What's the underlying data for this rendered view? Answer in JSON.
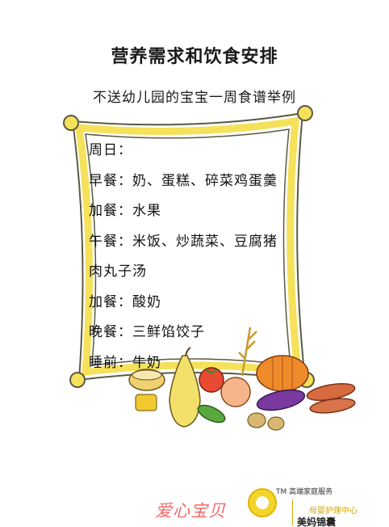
{
  "header": {
    "title": "营养需求和饮食安排",
    "subtitle": "不送幼儿园的宝宝一周食谱举例"
  },
  "menu": {
    "lines": [
      "周日：",
      "早餐：奶、蛋糕、碎菜鸡蛋羹",
      "加餐：水果",
      "午餐：米饭、炒蔬菜、豆腐猪",
      "肉丸子汤",
      "加餐：酸奶",
      "晚餐：三鲜馅饺子",
      "睡前：牛奶"
    ]
  },
  "branding": {
    "left_text": "爱心宝贝",
    "tm_text": "TM 高端家庭服务",
    "right_line1": "母婴护理中心",
    "right_line2": "美妈锦囊"
  },
  "colors": {
    "frame_yellow": "#f5e15a",
    "frame_outline": "#5c5a45",
    "brand_pink": "#ef6b6b",
    "brand_gold": "#d4a900"
  }
}
